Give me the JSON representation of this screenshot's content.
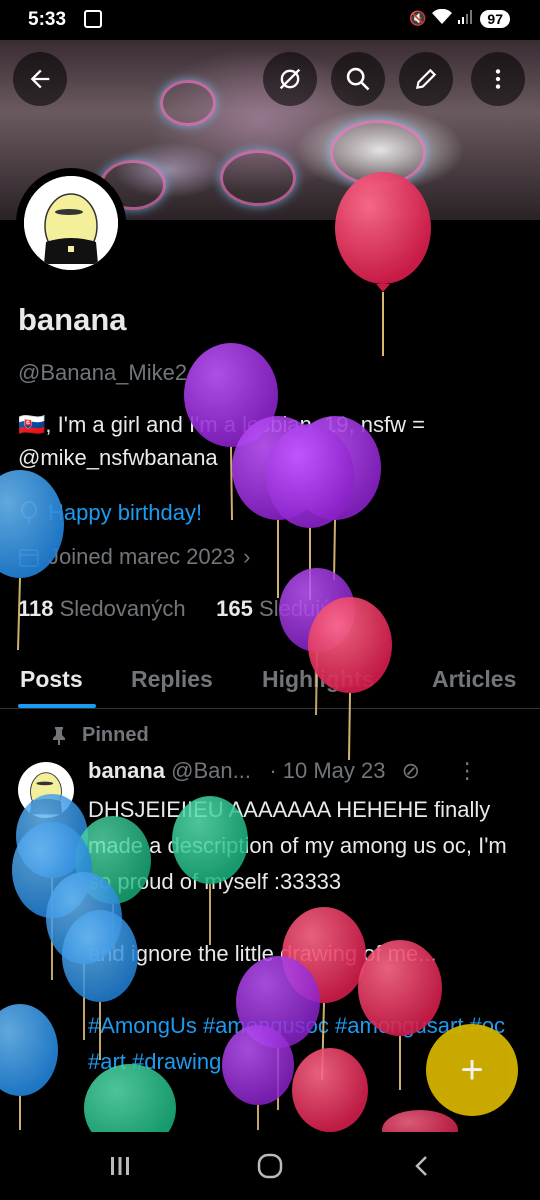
{
  "status_bar": {
    "time": "5:33",
    "battery": "97"
  },
  "profile": {
    "name": "banana",
    "handle": "@Banana_Mike2",
    "bio_flag": "🇸🇰",
    "bio_text": ", I'm a girl and I'm a lesbian, 19, nsfw = ",
    "bio_link": "@mike_nsfwbanana",
    "birthday": "Happy birthday!",
    "joined": "Joined marec 2023",
    "following_count": "118",
    "following_label": "Sledovaných",
    "followers_count": "165",
    "followers_label": "Sledujúci"
  },
  "tabs": [
    "Posts",
    "Replies",
    "Highlights",
    "Articles"
  ],
  "pinned_post": {
    "pinned_label": "Pinned",
    "author_name": "banana",
    "author_handle": "@Ban...",
    "date": "· 10 May 23",
    "text_line1": "DHSJEIEIIEU AAAAAAA HEHEHE finally made a description of my among us oc, I'm so proud of myself :33333",
    "text_line2": "and ignore the little drawing of me...",
    "hashtags": "#AmongUs #amongusoc #amongusart #oc #art #drawing"
  },
  "fab_label": "+",
  "colors": {
    "accent": "#1d9bf0",
    "background": "#000000",
    "muted_text": "#71767b",
    "fab": "#d4b300"
  }
}
